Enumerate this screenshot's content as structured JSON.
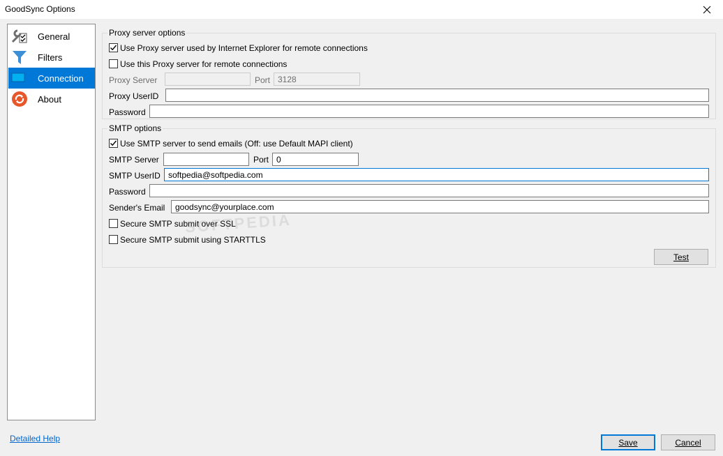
{
  "window": {
    "title": "GoodSync Options"
  },
  "sidebar": {
    "items": [
      {
        "label": "General",
        "icon": "wrench-checklist-icon"
      },
      {
        "label": "Filters",
        "icon": "funnel-icon"
      },
      {
        "label": "Connection",
        "icon": "monitor-icon",
        "selected": true
      },
      {
        "label": "About",
        "icon": "goodsync-logo-icon"
      }
    ]
  },
  "proxy": {
    "group_title": "Proxy server options",
    "use_ie_label": "Use Proxy server used by Internet Explorer for remote connections",
    "use_ie_checked": true,
    "use_this_label": "Use this Proxy server for remote connections",
    "use_this_checked": false,
    "server_label": "Proxy Server",
    "server_value": "",
    "port_label": "Port",
    "port_value": "3128",
    "userid_label": "Proxy UserID",
    "userid_value": "",
    "password_label": "Password",
    "password_value": ""
  },
  "smtp": {
    "group_title": "SMTP options",
    "use_smtp_label": "Use SMTP server to send emails (Off: use Default MAPI client)",
    "use_smtp_checked": true,
    "server_label": "SMTP Server",
    "server_value": "",
    "port_label": "Port",
    "port_value": "0",
    "userid_label": "SMTP UserID",
    "userid_value": "softpedia@softpedia.com",
    "password_label": "Password",
    "password_value": "",
    "sender_label": "Sender's Email",
    "sender_value": "goodsync@yourplace.com",
    "ssl_label": "Secure SMTP submit over SSL",
    "ssl_checked": false,
    "starttls_label": "Secure SMTP submit using STARTTLS",
    "starttls_checked": false,
    "test_button": "Test"
  },
  "footer": {
    "help_link": "Detailed Help",
    "save_button": "Save",
    "cancel_button": "Cancel"
  },
  "watermark": "SOFTPEDIA",
  "colors": {
    "accent": "#0078d7",
    "link": "#0066cc"
  }
}
